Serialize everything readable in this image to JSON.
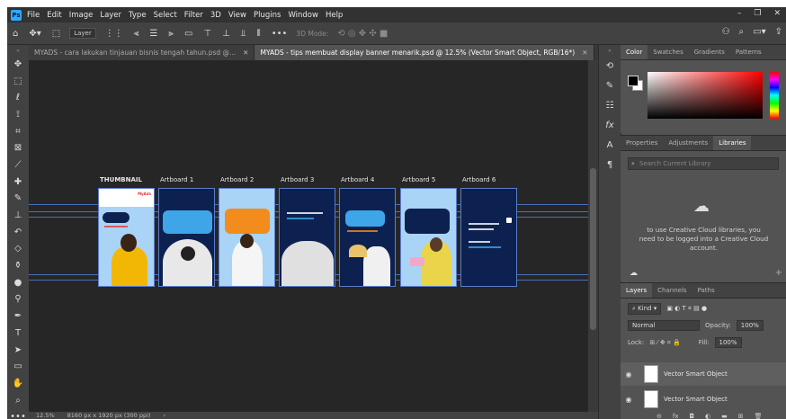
{
  "menubar": {
    "logo": "Ps",
    "items": [
      "File",
      "Edit",
      "Image",
      "Layer",
      "Type",
      "Select",
      "Filter",
      "3D",
      "View",
      "Plugins",
      "Window",
      "Help"
    ]
  },
  "options": {
    "layer_select": "Layer",
    "mode_3d": "3D Mode:"
  },
  "tabs": [
    {
      "label": "MYADS - cara lakukan tinjauan bisnis tengah tahun.psd @...",
      "active": false
    },
    {
      "label": "MYADS - tips membuat display banner menarik.psd @ 12.5% (Vector Smart Object, RGB/16*)",
      "active": true
    }
  ],
  "artboards": [
    {
      "label": "THUMBNAIL",
      "theme": "light"
    },
    {
      "label": "Artboard 1",
      "theme": "dark"
    },
    {
      "label": "Artboard 2",
      "theme": "light"
    },
    {
      "label": "Artboard 3",
      "theme": "dark"
    },
    {
      "label": "Artboard 4",
      "theme": "dark"
    },
    {
      "label": "Artboard 5",
      "theme": "light"
    },
    {
      "label": "Artboard 6",
      "theme": "dark"
    }
  ],
  "thumbnail_badge": "MyAds",
  "statusbar": {
    "zoom": "12.5%",
    "doc_size": "8160 px x 1920 px (300 ppi)"
  },
  "color_panel": {
    "tabs": [
      "Color",
      "Swatches",
      "Gradients",
      "Patterns"
    ]
  },
  "libraries_panel": {
    "tabs": [
      "Properties",
      "Adjustments",
      "Libraries"
    ],
    "search_placeholder": "Search Current Library",
    "message": "to use Creative Cloud libraries, you need to be logged into a Creative Cloud account."
  },
  "layers_panel": {
    "tabs": [
      "Layers",
      "Channels",
      "Paths"
    ],
    "filter": "Kind",
    "blend_mode": "Normal",
    "opacity_label": "Opacity:",
    "opacity": "100%",
    "lock_label": "Lock:",
    "fill_label": "Fill:",
    "fill": "100%",
    "layers": [
      {
        "name": "Vector Smart Object",
        "selected": true
      },
      {
        "name": "Vector Smart Object",
        "selected": false
      }
    ]
  },
  "colors": {
    "accent": "#31a8ff",
    "artboard_light": "#a9d4f5",
    "artboard_dark": "#0d2150",
    "guide": "#4a6fb8"
  }
}
